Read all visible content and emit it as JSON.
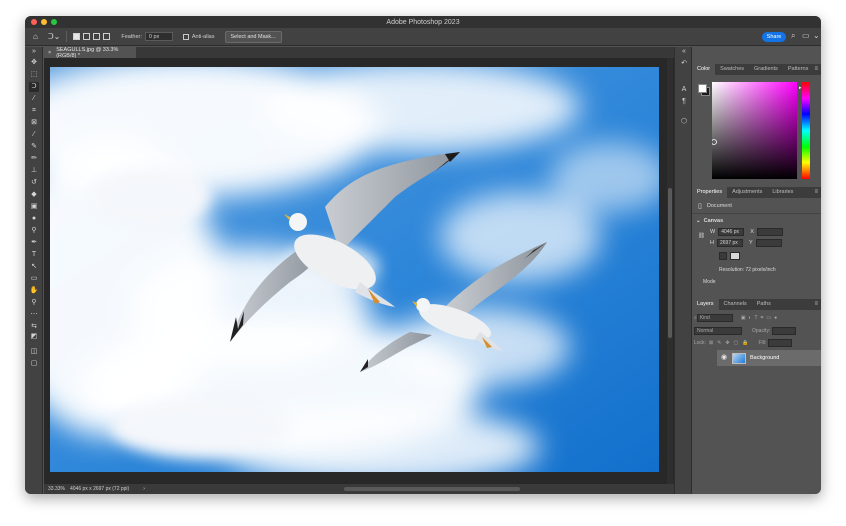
{
  "app": {
    "title": "Adobe Photoshop 2023"
  },
  "options_bar": {
    "feather_label": "Feather:",
    "feather_value": "0 px",
    "anti_alias_label": "Anti-alias",
    "select_mask_label": "Select and Mask...",
    "share_label": "Share"
  },
  "document": {
    "tab_label": "SEAGULLS.jpg @ 33.3% (RGB/8) *",
    "zoom": "33.33%",
    "status_info": "4046 px x 2697 px (72 ppi)"
  },
  "color_panel": {
    "tabs": [
      "Color",
      "Swatches",
      "Gradients",
      "Patterns"
    ],
    "foreground": "#ffffff",
    "background": "#1b1b1b",
    "hue_color": "#ff00ff"
  },
  "properties_panel": {
    "tabs": [
      "Properties",
      "Adjustments",
      "Libraries"
    ],
    "doc_label": "Document",
    "canvas_label": "Canvas",
    "w_label": "W",
    "w_value": "4046 px",
    "h_label": "H",
    "h_value": "2697 px",
    "x_label": "X",
    "y_label": "Y",
    "resolution": "Resolution: 72 pixels/inch",
    "mode_label": "Mode"
  },
  "layers_panel": {
    "tabs": [
      "Layers",
      "Channels",
      "Paths"
    ],
    "filter_placeholder": "Kind",
    "blend_mode": "Normal",
    "opacity_label": "Opacity:",
    "lock_label": "Lock:",
    "fill_label": "Fill:",
    "layers": [
      {
        "name": "Background"
      }
    ]
  },
  "accent": "#1473e6"
}
